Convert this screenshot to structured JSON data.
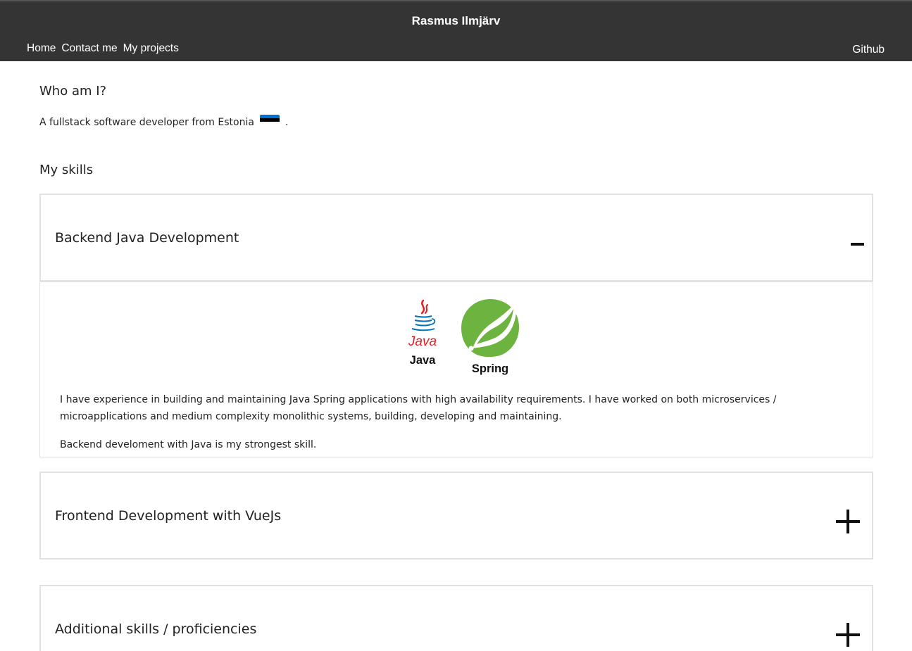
{
  "header": {
    "title": "Rasmus Ilmjärv",
    "nav": [
      "Home",
      "Contact me",
      "My projects"
    ],
    "github": "Github"
  },
  "about": {
    "heading": "Who am I?",
    "text": "A fullstack software developer from Estonia",
    "after_flag": ".",
    "flag_icon": "estonia-flag-icon"
  },
  "skills": {
    "heading": "My skills",
    "sections": [
      {
        "title": "Backend Java Development",
        "expanded": true,
        "logos": [
          {
            "name": "Java",
            "icon": "java-logo-icon"
          },
          {
            "name": "Spring",
            "icon": "spring-logo-icon"
          }
        ],
        "paragraphs": [
          "I have experience in building and maintaining Java Spring applications with high availability requirements. I have worked on both microservices / microapplications and medium complexity monolithic systems, building, developing and maintaining.",
          "Backend develoment with Java is my strongest skill."
        ]
      },
      {
        "title": "Frontend Development with VueJs",
        "expanded": false
      },
      {
        "title": "Additional skills / proficiencies",
        "expanded": false
      }
    ]
  },
  "colors": {
    "header_bg": "#343434",
    "border": "#e2e2e2",
    "spring_green": "#6db33f",
    "java_red": "#e11e22",
    "java_blue": "#0074bd"
  }
}
